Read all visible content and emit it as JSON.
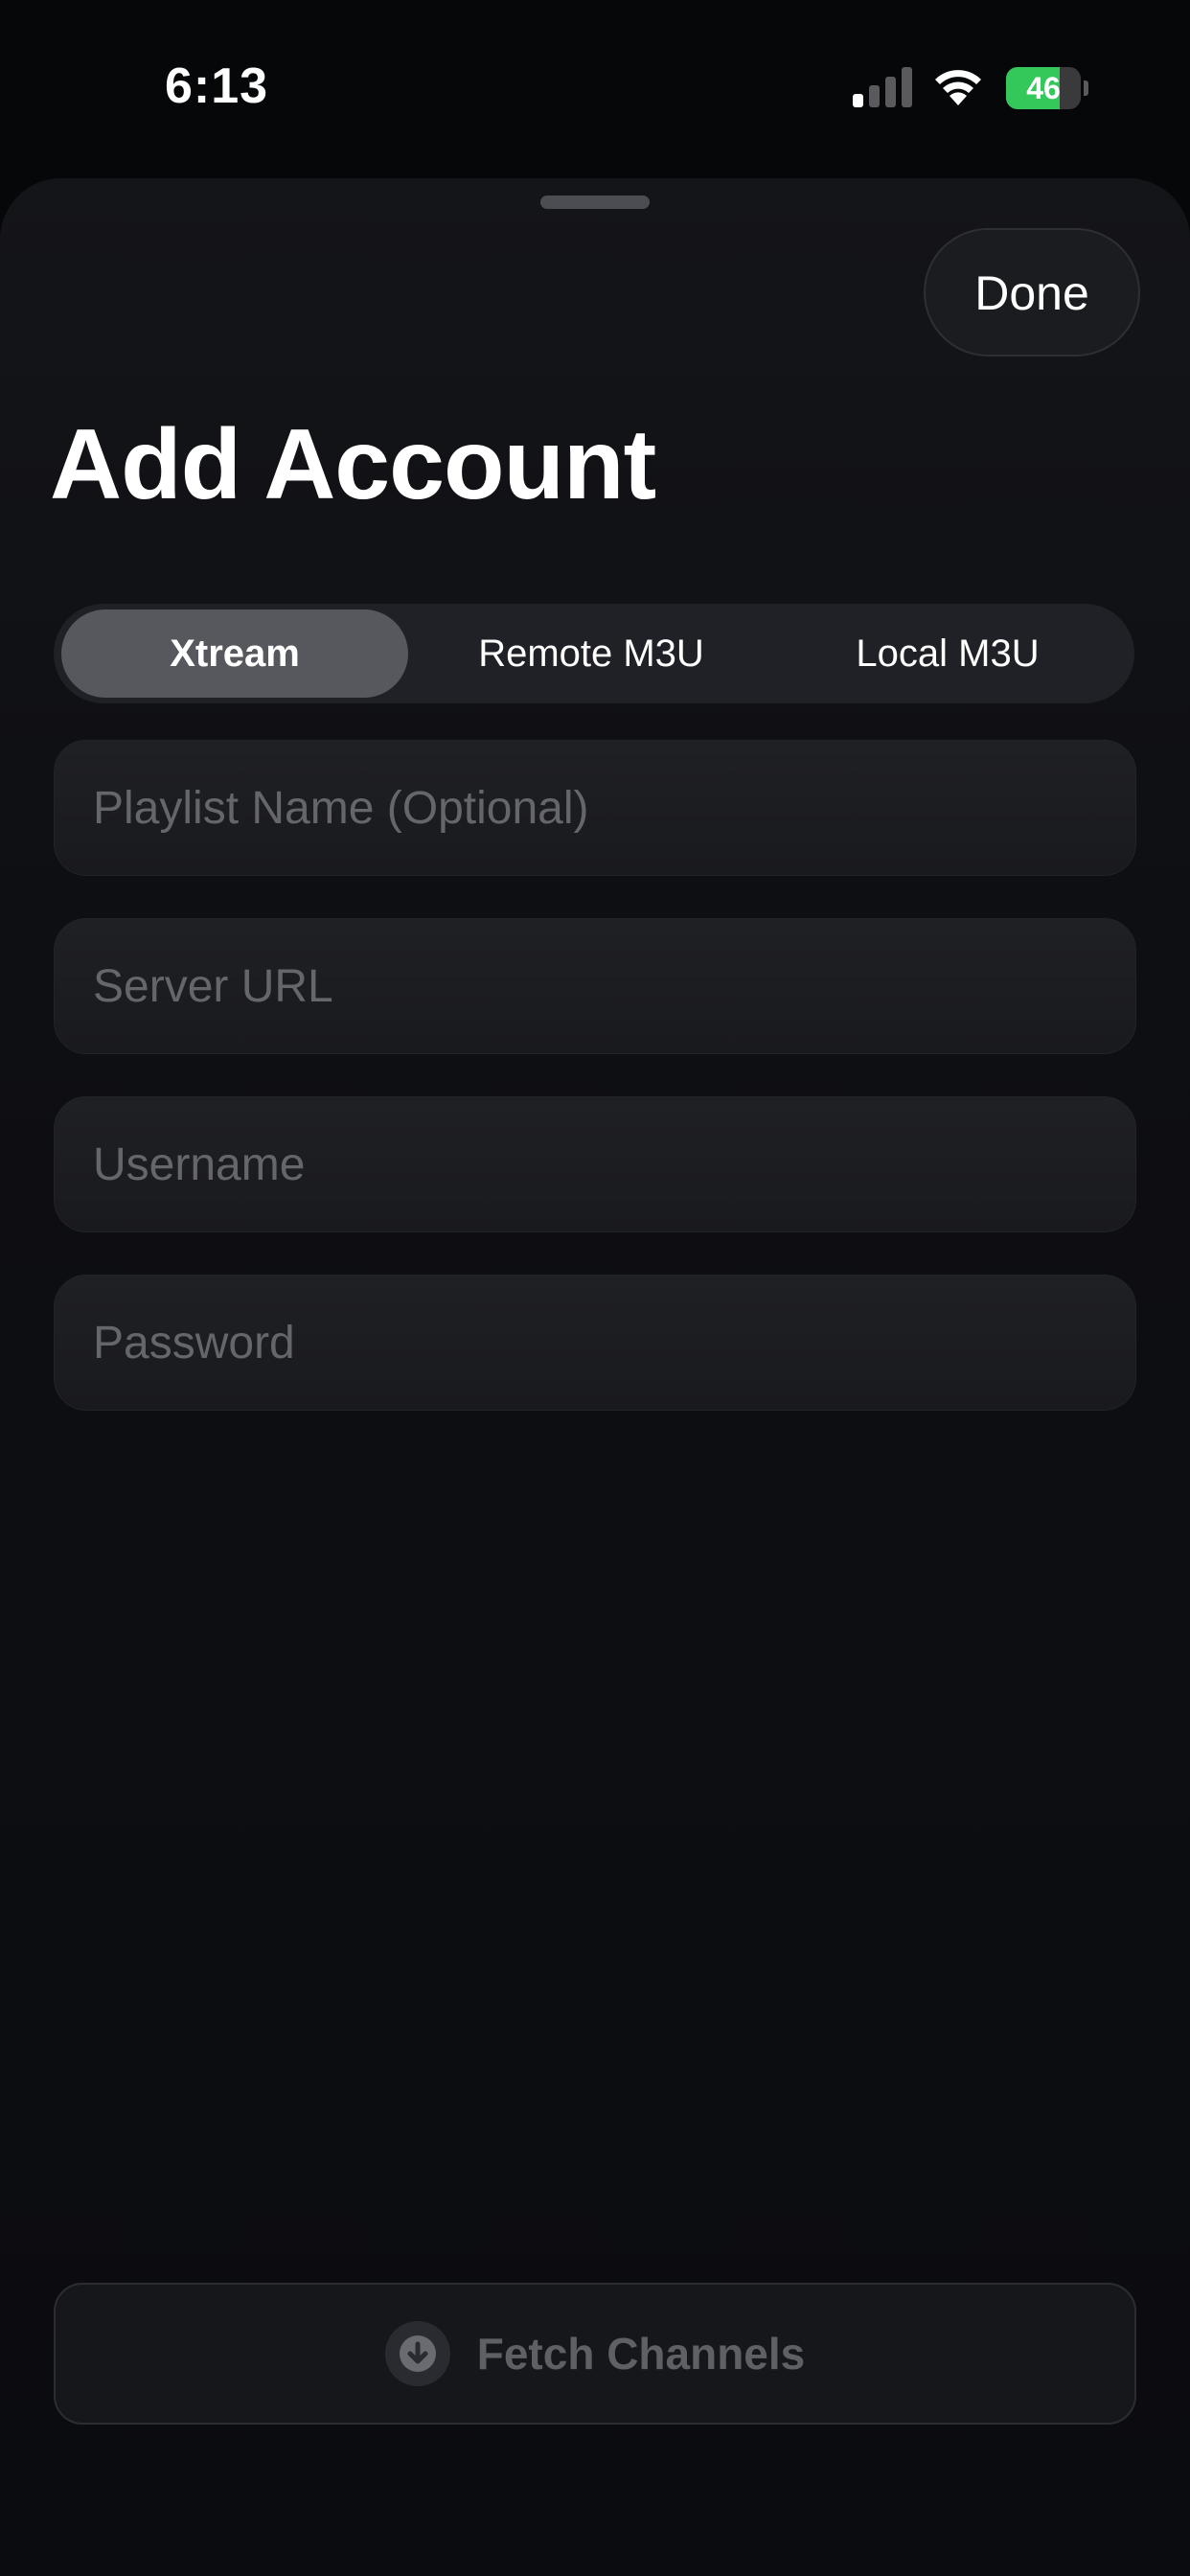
{
  "status_bar": {
    "time": "6:13",
    "battery_level": "46",
    "battery_percent": 46,
    "battery_color": "#34c759"
  },
  "sheet": {
    "done_label": "Done",
    "title": "Add Account"
  },
  "segmented": {
    "selected_index": 0,
    "options": [
      "Xtream",
      "Remote M3U",
      "Local M3U"
    ]
  },
  "form": {
    "fields": [
      {
        "placeholder": "Playlist Name (Optional)",
        "value": ""
      },
      {
        "placeholder": "Server URL",
        "value": ""
      },
      {
        "placeholder": "Username",
        "value": ""
      },
      {
        "placeholder": "Password",
        "value": ""
      }
    ]
  },
  "fetch_button": {
    "label": "Fetch Channels",
    "icon": "download-circle-icon",
    "enabled": false
  },
  "colors": {
    "background": "#060709",
    "sheet": "#141519",
    "segment_active": "#57585e",
    "placeholder": "#65666b",
    "disabled_text": "#5f6065"
  }
}
